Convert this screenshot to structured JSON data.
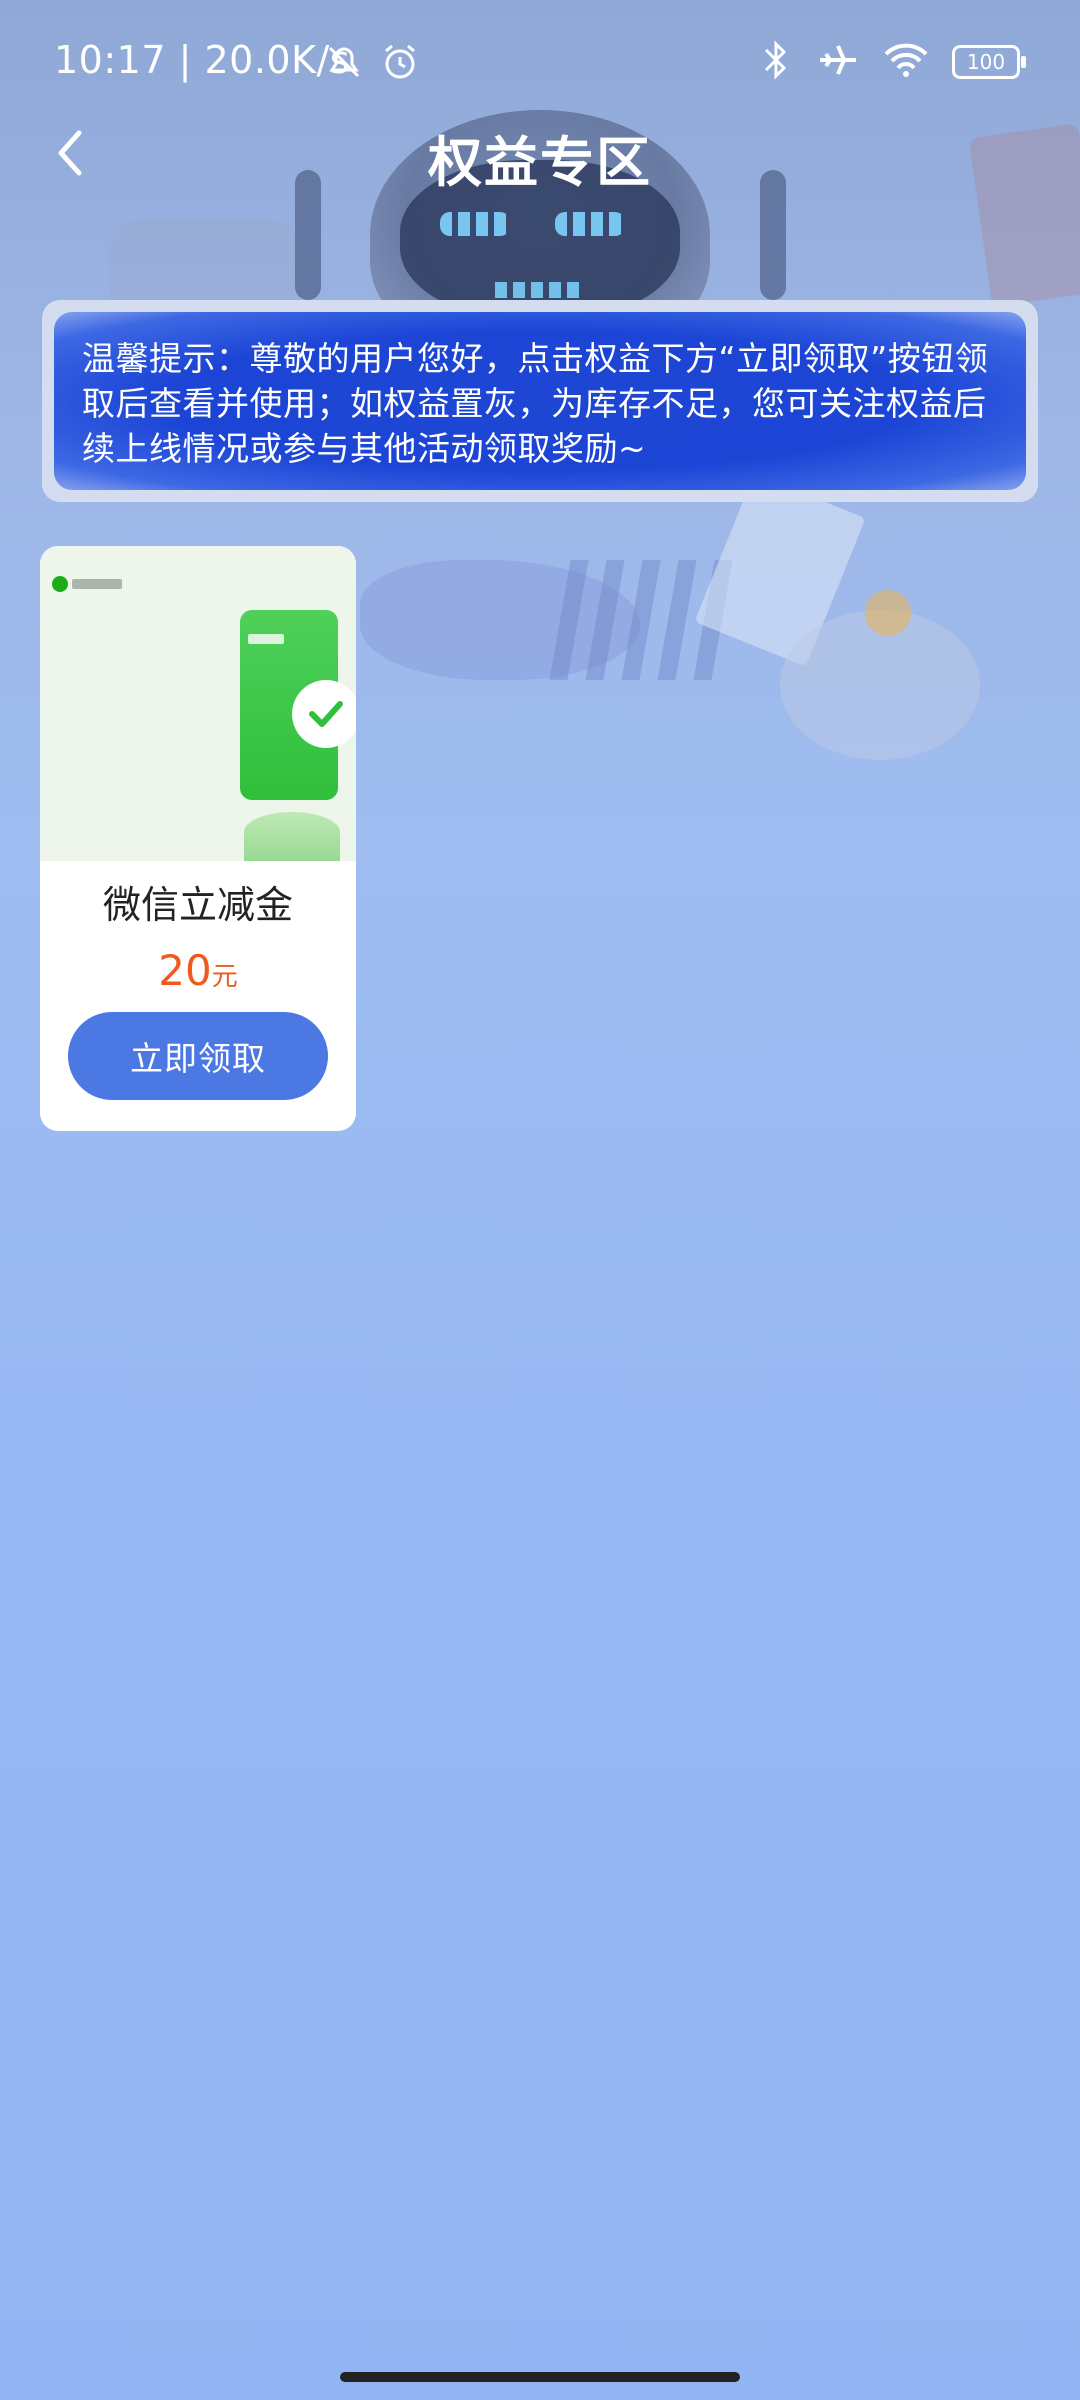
{
  "status_bar": {
    "time_and_speed": "10:17 | 20.0K/s",
    "battery": "100",
    "icons": [
      "mute-icon",
      "alarm-icon",
      "bluetooth-icon",
      "airplane-icon",
      "wifi-icon",
      "battery-icon"
    ]
  },
  "header": {
    "title": "权益专区",
    "back_icon": "chevron-left-icon"
  },
  "notice": {
    "text": "温馨提示：尊敬的用户您好，点击权益下方“立即领取”按钮领取后查看并使用；如权益置灰，为库存不足，您可关注权益后续上线情况或参与其他活动领取奖励~"
  },
  "benefits": [
    {
      "name": "微信立减金",
      "price_value": "20",
      "price_unit": "元",
      "button_label": "立即领取"
    }
  ],
  "colors": {
    "notice_bg": "#1f46d3",
    "button_bg": "#4b78e2",
    "price": "#ee5a1f",
    "wechat_green": "#2fbf3b"
  }
}
